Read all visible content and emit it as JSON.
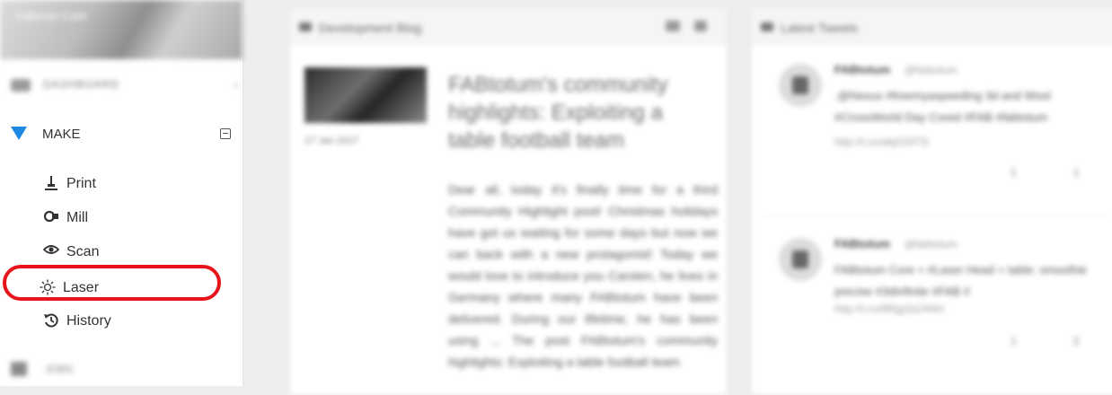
{
  "sidebar": {
    "banner_text": "Fabman Cam",
    "dashboard_label": "DASHBOARD",
    "dashboard_chevron": "«",
    "make": {
      "label": "MAKE",
      "collapse": ""
    },
    "items": [
      {
        "label": "Print",
        "icon": "printer-icon",
        "glyph": "⍊"
      },
      {
        "label": "Mill",
        "icon": "mill-icon",
        "glyph": "⚙"
      },
      {
        "label": "Scan",
        "icon": "eye-icon",
        "glyph": "👁"
      },
      {
        "label": "Laser",
        "icon": "laser-icon",
        "glyph": "☼"
      },
      {
        "label": "History",
        "icon": "history-icon",
        "glyph": "↺"
      }
    ],
    "jobs_label": "JOBS"
  },
  "blog": {
    "title": "Development Blog",
    "date": "17 Jan 2017",
    "post_title": "FABtotum's community highlights: Exploiting a table football team",
    "post_body": "Dear all, today it's finally time for a third Community Highlight post! Christmas holidays have got us waiting for some days but now we can back with a new protagonist! Today we would love to introduce you Carsten, he lives in Germany where many FABtotum have been delivered. During our lifetime, he has been using ... The post FABtotum's community highlights: Exploiting a table football team"
  },
  "tweets": {
    "title": "Latest Tweets",
    "items": [
      {
        "name": "FABtotum",
        "handle": "@fabtotum",
        "text": ".@Nexus #freemyaspeeding 3d and Wool #CrossWorld Day Cored #FAB #fabtotum",
        "link": "http://t.co/abjGSf72i",
        "rt": "1",
        "fav": "1"
      },
      {
        "name": "FABtotum",
        "handle": "@fabtotum",
        "text": "FABtotum Core + #Laser Head + table: smoothie precise #3dinfinite #FAB #",
        "link": "http://t.co/9Rjg1bZ4NH",
        "rt": "1",
        "fav": "2"
      }
    ]
  },
  "colors": {
    "accent": "#1e88e5",
    "highlight": "#e8141b"
  }
}
